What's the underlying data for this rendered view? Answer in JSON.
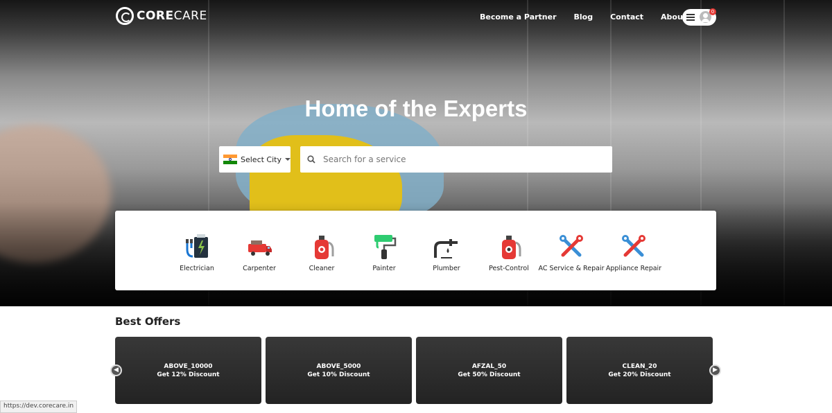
{
  "header": {
    "logo_bold": "CORE",
    "logo_light": "CARE",
    "nav": [
      {
        "label": "Become a Partner"
      },
      {
        "label": "Blog"
      },
      {
        "label": "Contact"
      },
      {
        "label": "About"
      }
    ],
    "cart_badge": "0"
  },
  "hero": {
    "title": "Home of the Experts",
    "city_label": "Select City",
    "search_placeholder": "Search for a service"
  },
  "services": [
    {
      "label": "Electrician",
      "icon": "electrician-icon"
    },
    {
      "label": "Carpenter",
      "icon": "carpenter-truck-icon"
    },
    {
      "label": "Cleaner",
      "icon": "cleaner-sprayer-icon"
    },
    {
      "label": "Painter",
      "icon": "paint-roller-icon"
    },
    {
      "label": "Plumber",
      "icon": "plumber-pipe-icon"
    },
    {
      "label": "Pest-Control",
      "icon": "pest-sprayer-icon"
    },
    {
      "label": "AC Service & Repair",
      "icon": "tools-icon"
    },
    {
      "label": "Appliance Repair",
      "icon": "tools-icon"
    }
  ],
  "offers": {
    "title": "Best Offers",
    "items": [
      {
        "code": "ABOVE_10000",
        "desc": "Get 12% Discount"
      },
      {
        "code": "ABOVE_5000",
        "desc": "Get 10% Discount"
      },
      {
        "code": "AFZAL_50",
        "desc": "Get 50% Discount"
      },
      {
        "code": "CLEAN_20",
        "desc": "Get 20% Discount"
      }
    ]
  },
  "status_url": "https://dev.corecare.in",
  "colors": {
    "accent": "#e53935",
    "card_bg": "#2d2d2d",
    "tool_blue": "#3a8fd6"
  }
}
